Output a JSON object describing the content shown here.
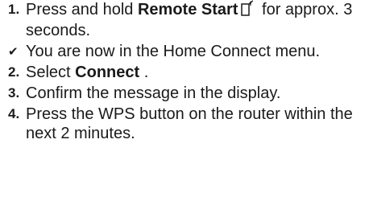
{
  "steps": [
    {
      "marker": "1.",
      "text_before": "Press and hold ",
      "bold": "Remote Start",
      "icon": "remote-start-icon",
      "text_after": " for approx. 3 seconds."
    },
    {
      "marker": "✔",
      "text": "You are now in the Home Connect menu."
    },
    {
      "marker": "2.",
      "text_before": "Select ",
      "bold": "Connect",
      "text_after": " ."
    },
    {
      "marker": "3.",
      "text": "Confirm the message in the display."
    },
    {
      "marker": "4.",
      "text": "Press the WPS button on the router within the next 2 minutes."
    }
  ]
}
